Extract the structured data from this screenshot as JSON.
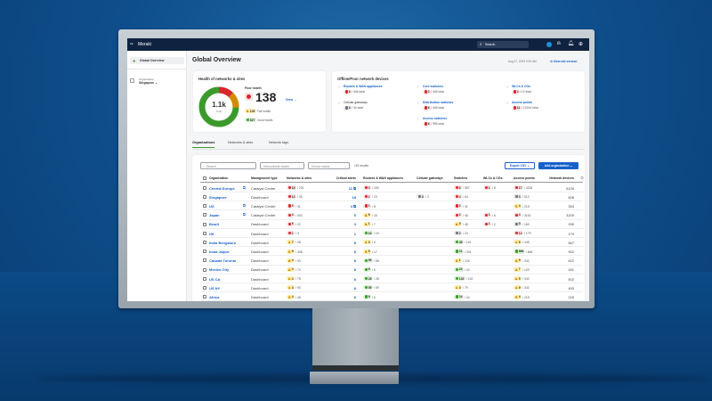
{
  "app": {
    "brand": "Meraki",
    "search_placeholder": "Search"
  },
  "sidebar": {
    "items": [
      {
        "label": "Global Overview"
      }
    ],
    "org_label": "Organization",
    "org_value": "Singapore"
  },
  "page": {
    "title": "Global Overview",
    "timestamp": "Aug 27, 2025 9:30 AM",
    "view_old": "View old version"
  },
  "health": {
    "title": "Health of networks & sites",
    "total": "1.1k",
    "total_label": "Total",
    "poor_label": "Poor health",
    "poor": "138",
    "view": "View",
    "fair": "145",
    "fair_label": "Fair health",
    "good": "827",
    "good_label": "Good health",
    "colors": {
      "good": "#3c9a2c",
      "fair": "#d48a00",
      "poor": "#d9262c"
    }
  },
  "offline": {
    "title": "Offline/Poor network devices",
    "items": [
      {
        "label": "Routers & WAN appliances",
        "count": "6",
        "total": "/ 346 total",
        "status": "red",
        "link": true
      },
      {
        "label": "Cellular gateways",
        "count": "3",
        "total": "/ 34 total",
        "status": "gray",
        "link": false
      },
      {
        "label": "Core switches",
        "count": "2",
        "total": "/ 446 total",
        "status": "red",
        "link": true
      },
      {
        "label": "Distribution switches",
        "count": "6",
        "total": "/ 446 total",
        "status": "red",
        "link": true
      },
      {
        "label": "Access switches",
        "count": "6",
        "total": "/ 996 total",
        "status": "red",
        "link": true
      },
      {
        "label": "WLCs & CGs",
        "count": "2",
        "total": "/ 12 total",
        "status": "red",
        "link": true
      },
      {
        "label": "Access points",
        "count": "11",
        "total": "/ 10214 total",
        "status": "red",
        "link": true
      }
    ]
  },
  "tabs": [
    {
      "label": "Organizations",
      "active": true
    },
    {
      "label": "Networks & sites"
    },
    {
      "label": "Network tags"
    }
  ],
  "filters": {
    "search_placeholder": "Search",
    "health": "Network/site health",
    "status": "Device status",
    "results": "115 results",
    "export": "Export CSV",
    "add": "Add organization"
  },
  "table": {
    "columns": [
      "Organization",
      "Management type",
      "Networks & sites",
      "Critical alerts",
      "Routers & WAN appliances",
      "Cellular gateways",
      "Switches",
      "WLCs & CGs",
      "Access points",
      "Network devices"
    ],
    "rows": [
      {
        "org": "Central Europe",
        "ext": true,
        "mgmt": "Catalyst Center",
        "nets": [
          "red",
          "18",
          "/ 231"
        ],
        "crit": "11",
        "critlink": true,
        "routers": [
          "red",
          "3",
          "/ 169"
        ],
        "cell": null,
        "sw": [
          "red",
          "6",
          "/ 567"
        ],
        "wlc": [
          "red",
          "1",
          "/ 6"
        ],
        "ap": [
          "red",
          "17",
          "/ 4334"
        ],
        "dev": "5109"
      },
      {
        "org": "Singapore",
        "ext": false,
        "mgmt": "Dashboard",
        "nets": [
          "red",
          "13",
          "/ 35"
        ],
        "crit": "18",
        "routers": [
          "red",
          "1",
          "/ 23"
        ],
        "cell": [
          "gray",
          "3",
          "/ 3"
        ],
        "sw": [
          "red",
          "4",
          "/ 64"
        ],
        "wlc": null,
        "ap": [
          "gray",
          "3",
          "/ 512"
        ],
        "dev": "508"
      },
      {
        "org": "US",
        "ext": true,
        "mgmt": "Catalyst Center",
        "nets": [
          "red",
          "9",
          "/ 31"
        ],
        "crit": "4",
        "critlink": true,
        "routers": [
          "red",
          "1",
          "/ 8"
        ],
        "cell": null,
        "sw": [
          "red",
          "2",
          "/ 31"
        ],
        "wlc": null,
        "ap": [
          "yellow",
          "4",
          "/ 215"
        ],
        "dev": "354"
      },
      {
        "org": "Japan",
        "ext": true,
        "mgmt": "Catalyst Center",
        "nets": [
          "red",
          "4",
          "/ 403"
        ],
        "crit": "5",
        "routers": [
          "yellow",
          "6",
          "/ 16"
        ],
        "cell": null,
        "sw": [
          "red",
          "2",
          "/ 46"
        ],
        "wlc": [
          "red",
          "1",
          "/ 6"
        ],
        "ap": [
          "red",
          "4",
          "/ 3116"
        ],
        "dev": "3209"
      },
      {
        "org": "Brazil",
        "ext": false,
        "mgmt": "Dashboard",
        "nets": [
          "red",
          "6",
          "/ 22"
        ],
        "crit": "3",
        "routers": [
          "yellow",
          "1",
          "/ 7"
        ],
        "cell": null,
        "sw": [
          "yellow",
          "9",
          "/ 48"
        ],
        "wlc": [
          "red",
          "1",
          "/ 2"
        ],
        "ap": [
          "gray",
          "5",
          "/ 169"
        ],
        "dev": "255"
      },
      {
        "org": "UK",
        "ext": false,
        "mgmt": "Dashboard",
        "nets": [
          "red",
          "1",
          "/ 3"
        ],
        "crit": "1",
        "routers": [
          "green",
          "16",
          "/ 16"
        ],
        "cell": null,
        "sw": [
          "gray",
          "2",
          "/ 24"
        ],
        "wlc": null,
        "ap": [
          "red",
          "12",
          "/ 179"
        ],
        "dev": "179"
      },
      {
        "org": "India Bengaluru",
        "ext": false,
        "mgmt": "Dashboard",
        "nets": [
          "yellow",
          "7",
          "/ 28"
        ],
        "crit": "8",
        "routers": [
          "yellow",
          "3",
          "/ 6"
        ],
        "cell": null,
        "sw": [
          "green",
          "38",
          "/ 119"
        ],
        "wlc": null,
        "ap": [
          "yellow",
          "5",
          "/ 445"
        ],
        "dev": "567"
      },
      {
        "org": "India Jaipur",
        "ext": false,
        "mgmt": "Dashboard",
        "nets": [
          "yellow",
          "9",
          "/ 338"
        ],
        "crit": "8",
        "routers": [
          "yellow",
          "5",
          "/ 17"
        ],
        "cell": null,
        "sw": [
          "green",
          "21",
          "/ 331"
        ],
        "wlc": null,
        "ap": [
          "green",
          "866",
          "/ 866"
        ],
        "dev": "902"
      },
      {
        "org": "Canada Toronto",
        "ext": false,
        "mgmt": "Dashboard",
        "nets": [
          "yellow",
          "4",
          "/ 93"
        ],
        "crit": "8",
        "routers": [
          "green",
          "56",
          "/ 58"
        ],
        "cell": null,
        "sw": [
          "yellow",
          "1",
          "/ 126"
        ],
        "wlc": null,
        "ap": [
          "yellow",
          "9",
          "/ 342"
        ],
        "dev": "522"
      },
      {
        "org": "Mexico City",
        "ext": false,
        "mgmt": "Dashboard",
        "nets": [
          "yellow",
          "4",
          "/ 74"
        ],
        "crit": "8",
        "routers": [
          "green",
          "6",
          "/ 6"
        ],
        "cell": null,
        "sw": [
          "green",
          "24",
          "/ 24"
        ],
        "wlc": null,
        "ap": [
          "yellow",
          "7",
          "/ 129"
        ],
        "dev": "181"
      },
      {
        "org": "US CA",
        "ext": false,
        "mgmt": "Dashboard",
        "nets": [
          "yellow",
          "4",
          "/ 78"
        ],
        "crit": "8",
        "routers": [
          "green",
          "28",
          "/ 28"
        ],
        "cell": null,
        "sw": [
          "green",
          "132",
          "/ 132"
        ],
        "wlc": null,
        "ap": [
          "yellow",
          "9",
          "/ 342"
        ],
        "dev": "502"
      },
      {
        "org": "US NY",
        "ext": false,
        "mgmt": "Dashboard",
        "nets": [
          "yellow",
          "4",
          "/ 93"
        ],
        "crit": "8",
        "routers": [
          "green",
          "59",
          "/ 59"
        ],
        "cell": null,
        "sw": [
          "yellow",
          "3",
          "/ 79"
        ],
        "wlc": null,
        "ap": [
          "yellow",
          "9",
          "/ 342"
        ],
        "dev": "493"
      },
      {
        "org": "Africa",
        "ext": false,
        "mgmt": "Dashboard",
        "nets": [
          "yellow",
          "4",
          "/ 45"
        ],
        "crit": "8",
        "routers": [
          "green",
          "6",
          "/ 6"
        ],
        "cell": null,
        "sw": [
          "green",
          "24",
          "/ 24"
        ],
        "wlc": null,
        "ap": [
          "yellow",
          "4",
          "/ 215"
        ],
        "dev": "249"
      }
    ]
  }
}
